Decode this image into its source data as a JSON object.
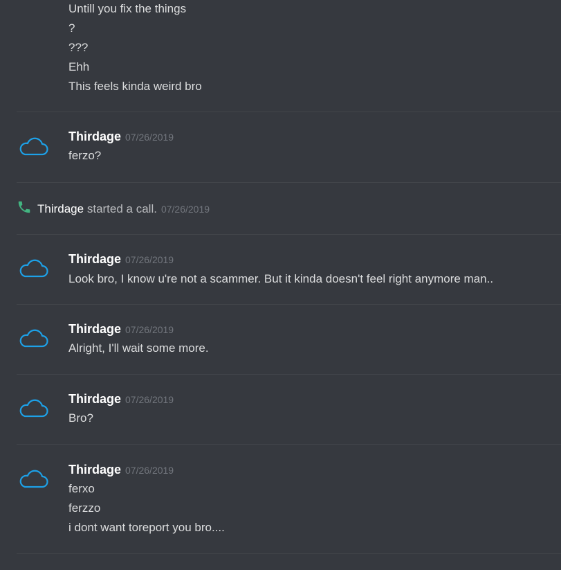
{
  "messages_top": {
    "lines": [
      "Untill you fix the things",
      "?",
      "???",
      "Ehh",
      "This feels kinda weird bro"
    ]
  },
  "message_1": {
    "author": "Thirdage",
    "time": "07/26/2019",
    "lines": [
      "ferzo?"
    ]
  },
  "call_event": {
    "author": "Thirdage",
    "text": "started a call.",
    "time": "07/26/2019"
  },
  "message_2": {
    "author": "Thirdage",
    "time": "07/26/2019",
    "lines": [
      "Look bro, I know u're not a scammer. But it kinda doesn't feel right anymore man.."
    ]
  },
  "message_3": {
    "author": "Thirdage",
    "time": "07/26/2019",
    "lines": [
      "Alright, I'll wait some more."
    ]
  },
  "message_4": {
    "author": "Thirdage",
    "time": "07/26/2019",
    "lines": [
      "Bro?"
    ]
  },
  "message_5": {
    "author": "Thirdage",
    "time": "07/26/2019",
    "lines": [
      "ferxo",
      "ferzzo",
      "i dont want toreport you bro...."
    ]
  },
  "colors": {
    "background": "#36393f",
    "avatar_cloud": "#1da1e8",
    "phone_icon": "#43b581",
    "timestamp": "#72767d",
    "author": "#ffffff",
    "text": "#dcddde"
  },
  "icons": {
    "avatar": "cloud-icon",
    "call": "phone-icon"
  }
}
